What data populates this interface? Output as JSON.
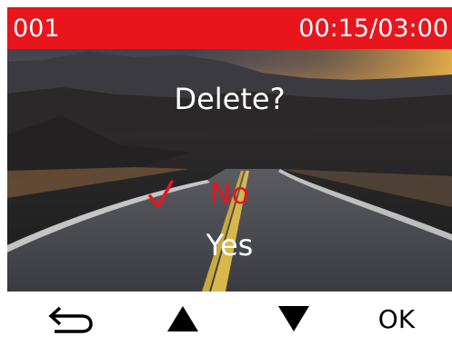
{
  "status_bar": {
    "file_number": "001",
    "time_position": "00:15/03:00",
    "background_color": "#e8151d"
  },
  "dialog": {
    "title": "Delete?",
    "options": [
      {
        "label": "No",
        "selected": true,
        "color": "#e8151d"
      },
      {
        "label": "Yes",
        "selected": false,
        "color": "#ffffff"
      }
    ],
    "selected_icon": "checkmark-icon"
  },
  "buttons": {
    "back_icon": "back-arrow-icon",
    "up_icon": "up-triangle-icon",
    "down_icon": "down-triangle-icon",
    "ok_label": "OK"
  }
}
